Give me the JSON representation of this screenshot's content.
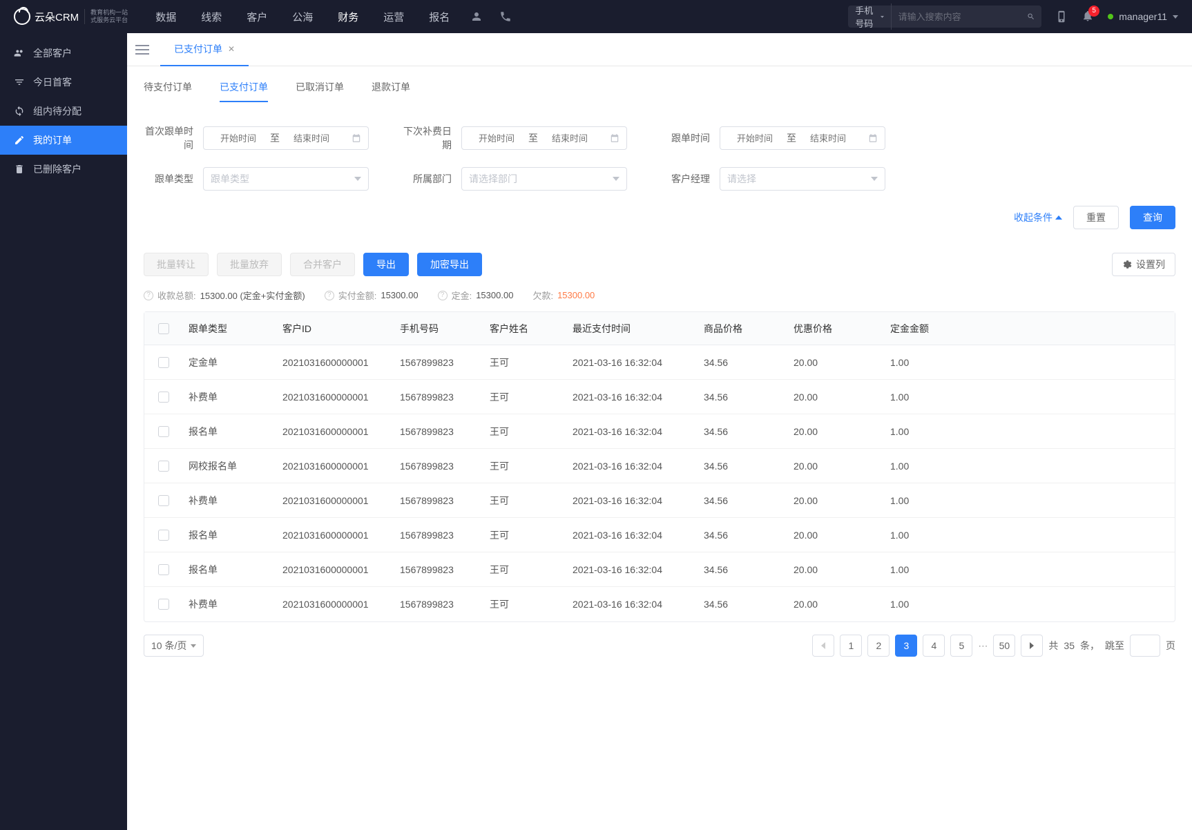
{
  "header": {
    "logo_main": "云朵CRM",
    "logo_sub1": "教育机构一站",
    "logo_sub2": "式服务云平台",
    "nav": [
      "数据",
      "线索",
      "客户",
      "公海",
      "财务",
      "运营",
      "报名"
    ],
    "nav_active_index": 4,
    "search_type": "手机号码",
    "search_placeholder": "请输入搜索内容",
    "notification_count": "5",
    "user_name": "manager11"
  },
  "sidebar": {
    "items": [
      {
        "label": "全部客户",
        "icon": "users"
      },
      {
        "label": "今日首客",
        "icon": "filter"
      },
      {
        "label": "组内待分配",
        "icon": "refresh"
      },
      {
        "label": "我的订单",
        "icon": "edit"
      },
      {
        "label": "已删除客户",
        "icon": "trash"
      }
    ],
    "active_index": 3
  },
  "tab": {
    "label": "已支付订单"
  },
  "subtabs": {
    "items": [
      "待支付订单",
      "已支付订单",
      "已取消订单",
      "退款订单"
    ],
    "active_index": 1
  },
  "filters": {
    "first_follow_label": "首次跟单时间",
    "start_ph": "开始时间",
    "to": "至",
    "end_ph": "结束时间",
    "next_renew_label": "下次补费日期",
    "follow_time_label": "跟单时间",
    "follow_type_label": "跟单类型",
    "follow_type_ph": "跟单类型",
    "dept_label": "所属部门",
    "dept_ph": "请选择部门",
    "manager_label": "客户经理",
    "manager_ph": "请选择",
    "collapse": "收起条件",
    "reset": "重置",
    "query": "查询"
  },
  "actions": {
    "batch_transfer": "批量转让",
    "batch_abandon": "批量放弃",
    "merge": "合并客户",
    "export": "导出",
    "encrypt_export": "加密导出",
    "columns": "设置列"
  },
  "summary": {
    "total_label": "收款总额:",
    "total_value": "15300.00 (定金+实付金额)",
    "paid_label": "实付金额:",
    "paid_value": "15300.00",
    "deposit_label": "定金:",
    "deposit_value": "15300.00",
    "owed_label": "欠款:",
    "owed_value": "15300.00"
  },
  "table": {
    "headers": [
      "跟单类型",
      "客户ID",
      "手机号码",
      "客户姓名",
      "最近支付时间",
      "商品价格",
      "优惠价格",
      "定金金额"
    ],
    "rows": [
      {
        "type": "定金单",
        "cid": "2021031600000001",
        "phone": "1567899823",
        "name": "王可",
        "time": "2021-03-16 16:32:04",
        "price": "34.56",
        "discount": "20.00",
        "deposit": "1.00"
      },
      {
        "type": "补费单",
        "cid": "2021031600000001",
        "phone": "1567899823",
        "name": "王可",
        "time": "2021-03-16 16:32:04",
        "price": "34.56",
        "discount": "20.00",
        "deposit": "1.00"
      },
      {
        "type": "报名单",
        "cid": "2021031600000001",
        "phone": "1567899823",
        "name": "王可",
        "time": "2021-03-16 16:32:04",
        "price": "34.56",
        "discount": "20.00",
        "deposit": "1.00"
      },
      {
        "type": "网校报名单",
        "cid": "2021031600000001",
        "phone": "1567899823",
        "name": "王可",
        "time": "2021-03-16 16:32:04",
        "price": "34.56",
        "discount": "20.00",
        "deposit": "1.00"
      },
      {
        "type": "补费单",
        "cid": "2021031600000001",
        "phone": "1567899823",
        "name": "王可",
        "time": "2021-03-16 16:32:04",
        "price": "34.56",
        "discount": "20.00",
        "deposit": "1.00"
      },
      {
        "type": "报名单",
        "cid": "2021031600000001",
        "phone": "1567899823",
        "name": "王可",
        "time": "2021-03-16 16:32:04",
        "price": "34.56",
        "discount": "20.00",
        "deposit": "1.00"
      },
      {
        "type": "报名单",
        "cid": "2021031600000001",
        "phone": "1567899823",
        "name": "王可",
        "time": "2021-03-16 16:32:04",
        "price": "34.56",
        "discount": "20.00",
        "deposit": "1.00"
      },
      {
        "type": "补费单",
        "cid": "2021031600000001",
        "phone": "1567899823",
        "name": "王可",
        "time": "2021-03-16 16:32:04",
        "price": "34.56",
        "discount": "20.00",
        "deposit": "1.00"
      }
    ]
  },
  "pagination": {
    "per_page": "10 条/页",
    "pages": [
      "1",
      "2",
      "3",
      "4",
      "5"
    ],
    "active_page": "3",
    "last": "50",
    "total_prefix": "共",
    "total_count": "35",
    "total_suffix": "条，",
    "jump": "跳至",
    "page_suffix": "页"
  }
}
